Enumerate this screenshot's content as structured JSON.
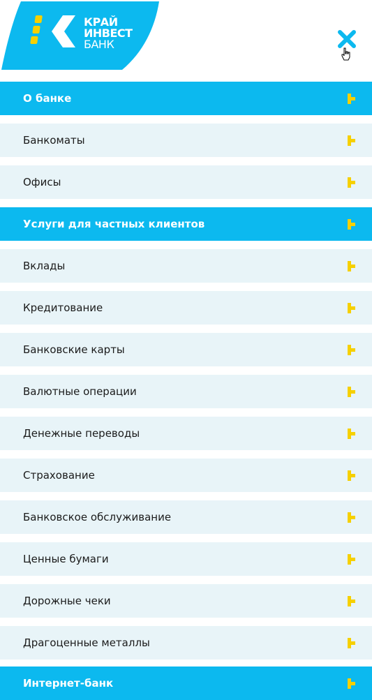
{
  "brand": {
    "logo_lines": [
      "КРАЙ",
      "ИНВЕСТ",
      "БАНК"
    ],
    "logo_color": "#0cb9ef",
    "logo_mark_color": "#f6d000",
    "logo_icon": "kraiinvest-k-logo"
  },
  "header": {
    "close_icon": "close-icon",
    "close_color": "#0cb9ef"
  },
  "menu": {
    "items": [
      {
        "label": "О банке",
        "kind": "section"
      },
      {
        "label": "Банкоматы",
        "kind": "item"
      },
      {
        "label": "Офисы",
        "kind": "item"
      },
      {
        "label": "Услуги для частных клиентов",
        "kind": "section"
      },
      {
        "label": "Вклады",
        "kind": "item"
      },
      {
        "label": "Кредитование",
        "kind": "item"
      },
      {
        "label": "Банковские карты",
        "kind": "item"
      },
      {
        "label": "Валютные операции",
        "kind": "item"
      },
      {
        "label": "Денежные переводы",
        "kind": "item"
      },
      {
        "label": "Страхование",
        "kind": "item"
      },
      {
        "label": "Банковское обслуживание",
        "kind": "item"
      },
      {
        "label": "Ценные бумаги",
        "kind": "item"
      },
      {
        "label": "Дорожные чеки",
        "kind": "item"
      },
      {
        "label": "Драгоценные металлы",
        "kind": "item"
      },
      {
        "label": "Интернет-банк",
        "kind": "section"
      }
    ],
    "arrow_icon": "chevron-right-pixel-icon",
    "colors": {
      "section_bg": "#0cb9ef",
      "item_bg": "#e8f4f8",
      "arrow": "#f6d000"
    }
  }
}
